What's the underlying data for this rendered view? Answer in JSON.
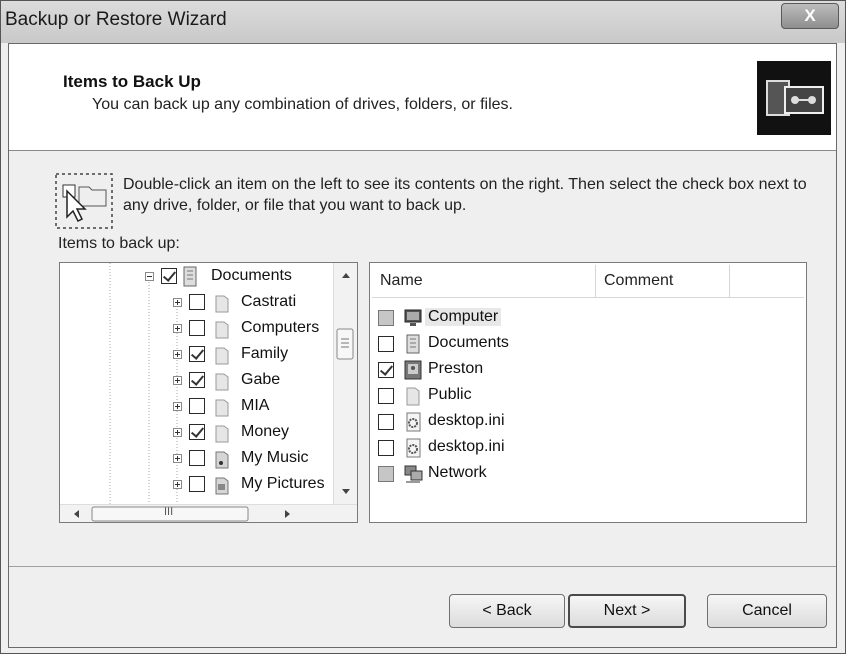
{
  "window": {
    "title": "Backup or Restore Wizard",
    "close_glyph": "X"
  },
  "header": {
    "title": "Items to Back Up",
    "subtitle": "You can back up any combination of drives, folders, or files.",
    "icon": "backup-icon"
  },
  "hint": {
    "text": "Double-click an item on the left to see its contents on the right. Then select the check box next to any drive, folder, or file that you want to back up."
  },
  "items_label": "Items to back up:",
  "tree": {
    "root": {
      "label": "Documents",
      "checked": true,
      "expander": "minus"
    },
    "children": [
      {
        "label": "Castrati",
        "checked": false
      },
      {
        "label": "Computers",
        "checked": false
      },
      {
        "label": "Family",
        "checked": true
      },
      {
        "label": "Gabe",
        "checked": true
      },
      {
        "label": "MIA",
        "checked": false
      },
      {
        "label": "Money",
        "checked": true
      },
      {
        "label": "My Music",
        "checked": false
      },
      {
        "label": "My Pictures",
        "checked": false
      }
    ],
    "hscroll_grip": "III"
  },
  "list": {
    "columns": [
      "Name",
      "Comment"
    ],
    "items": [
      {
        "label": "Computer",
        "state": "mixed",
        "icon": "computer-icon"
      },
      {
        "label": "Documents",
        "state": "unchecked",
        "icon": "documents-folder-icon"
      },
      {
        "label": "Preston",
        "state": "checked",
        "icon": "user-folder-icon"
      },
      {
        "label": "Public",
        "state": "unchecked",
        "icon": "folder-icon"
      },
      {
        "label": "desktop.ini",
        "state": "unchecked",
        "icon": "settings-file-icon"
      },
      {
        "label": "desktop.ini",
        "state": "unchecked",
        "icon": "settings-file-icon"
      },
      {
        "label": "Network",
        "state": "mixed",
        "icon": "network-icon"
      }
    ]
  },
  "buttons": {
    "back": "< Back",
    "next": "Next >",
    "cancel": "Cancel"
  }
}
